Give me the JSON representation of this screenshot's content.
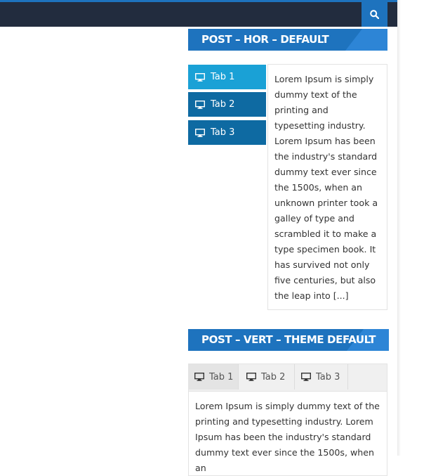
{
  "header": {
    "accent": "#1e73be",
    "bar_color": "#222c3e",
    "search_icon": "search-icon"
  },
  "widget1": {
    "title": "POST – HOR – DEFAULT",
    "tabs": [
      {
        "label": "Tab 1",
        "icon": "monitor-icon",
        "active": true
      },
      {
        "label": "Tab 2",
        "icon": "monitor-icon",
        "active": false
      },
      {
        "label": "Tab 3",
        "icon": "monitor-icon",
        "active": false
      }
    ],
    "content": "Lorem Ipsum is simply dummy text of the printing and typesetting industry. Lorem Ipsum has been the industry's standard dummy text ever since the 1500s, when an unknown printer took a galley of type and scrambled it to make a type specimen book. It has survived not only five centuries, but also the leap into [...]"
  },
  "widget2": {
    "title": "POST – VERT – THEME DEFAULT",
    "tabs": [
      {
        "label": "Tab 1",
        "icon": "monitor-icon",
        "active": true
      },
      {
        "label": "Tab 2",
        "icon": "monitor-icon",
        "active": false
      },
      {
        "label": "Tab 3",
        "icon": "monitor-icon",
        "active": false
      }
    ],
    "content": "Lorem Ipsum is simply dummy text of the printing and typesetting industry. Lorem Ipsum has been the industry's standard dummy text ever since the 1500s, when an"
  }
}
